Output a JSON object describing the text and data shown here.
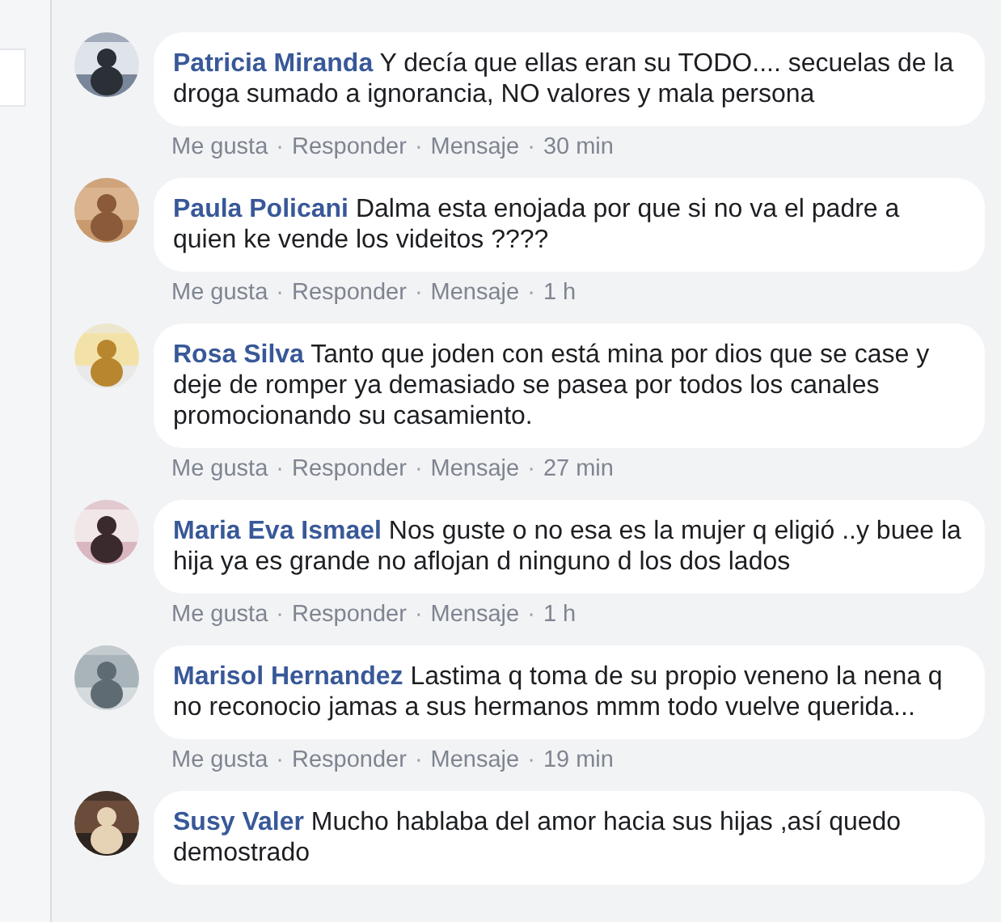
{
  "comments": [
    {
      "author": "Patricia Miranda",
      "text": "Y decía que ellas eran su TODO.... secuelas de la droga sumado a ignorancia, NO valores y mala persona",
      "actions": [
        {
          "kind": "link",
          "label": "Me gusta"
        },
        {
          "kind": "sep",
          "label": "·"
        },
        {
          "kind": "link",
          "label": "Responder"
        },
        {
          "kind": "sep",
          "label": "·"
        },
        {
          "kind": "link",
          "label": "Mensaje"
        },
        {
          "kind": "sep",
          "label": "·"
        },
        {
          "kind": "time",
          "label": "30 min"
        }
      ]
    },
    {
      "author": "Paula Policani",
      "text": "Dalma esta enojada por que si no va el padre a quien ke vende los videitos ????",
      "actions": [
        {
          "kind": "link",
          "label": "Me gusta"
        },
        {
          "kind": "sep",
          "label": "·"
        },
        {
          "kind": "link",
          "label": "Responder"
        },
        {
          "kind": "sep",
          "label": "·"
        },
        {
          "kind": "link",
          "label": "Mensaje"
        },
        {
          "kind": "sep",
          "label": "·"
        },
        {
          "kind": "time",
          "label": "1 h"
        }
      ]
    },
    {
      "author": "Rosa Silva",
      "text": "Tanto que joden con está mina por dios que se case y deje de romper ya demasiado se pasea por todos los canales promocionando su casamiento.",
      "actions": [
        {
          "kind": "link",
          "label": "Me gusta"
        },
        {
          "kind": "sep",
          "label": "·"
        },
        {
          "kind": "link",
          "label": "Responder"
        },
        {
          "kind": "sep",
          "label": "·"
        },
        {
          "kind": "link",
          "label": "Mensaje"
        },
        {
          "kind": "sep",
          "label": "·"
        },
        {
          "kind": "time",
          "label": "27 min"
        }
      ]
    },
    {
      "author": "Maria Eva Ismael",
      "text": "Nos guste o no esa es la mujer q eligió ..y buee la hija ya es grande no aflojan d ninguno d los dos lados",
      "actions": [
        {
          "kind": "link",
          "label": "Me gusta"
        },
        {
          "kind": "sep",
          "label": "·"
        },
        {
          "kind": "link",
          "label": "Responder"
        },
        {
          "kind": "sep",
          "label": "·"
        },
        {
          "kind": "link",
          "label": "Mensaje"
        },
        {
          "kind": "sep",
          "label": "·"
        },
        {
          "kind": "time",
          "label": "1 h"
        }
      ]
    },
    {
      "author": "Marisol Hernandez",
      "text": "Lastima q toma de su propio veneno la nena q no reconocio jamas a sus hermanos mmm todo vuelve querida...",
      "actions": [
        {
          "kind": "link",
          "label": "Me gusta"
        },
        {
          "kind": "sep",
          "label": "·"
        },
        {
          "kind": "link",
          "label": "Responder"
        },
        {
          "kind": "sep",
          "label": "·"
        },
        {
          "kind": "link",
          "label": "Mensaje"
        },
        {
          "kind": "sep",
          "label": "·"
        },
        {
          "kind": "time",
          "label": "19 min"
        }
      ]
    },
    {
      "author": "Susy Valer",
      "text": "Mucho hablaba del amor hacia sus hijas ,así quedo demostrado"
    }
  ]
}
